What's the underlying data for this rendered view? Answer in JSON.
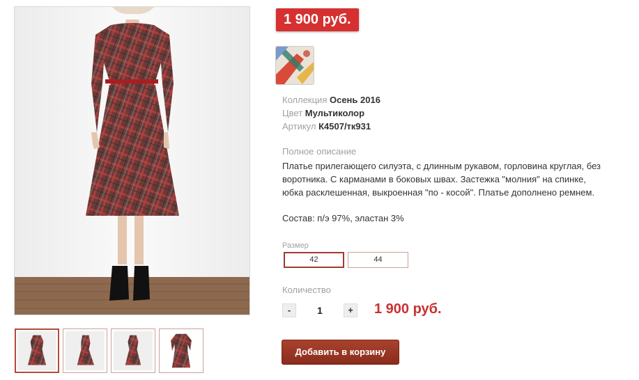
{
  "product": {
    "price_badge": "1 900 руб.",
    "properties": [
      {
        "label": "Коллекция",
        "value": "Осень 2016"
      },
      {
        "label": "Цвет",
        "value": "Мультиколор"
      },
      {
        "label": "Артикул",
        "value": "К4507/тк931"
      }
    ],
    "description_title": "Полное описание",
    "description": "Платье прилегающего силуэта, с длинным рукавом, горловина круглая, без воротника. С карманами в боковых швах. Застежка \"молния\" на спинке, юбка расклешенная, выкроенная \"по - косой\". Платье дополнено ремнем.",
    "composition": "Состав: п/э 97%, эластан 3%"
  },
  "size": {
    "label": "Размер",
    "options": [
      "42",
      "44"
    ],
    "selected": "42"
  },
  "quantity": {
    "label": "Количество",
    "minus": "-",
    "value": "1",
    "plus": "+",
    "total": "1 900 руб."
  },
  "add_to_cart": "Добавить в корзину",
  "gallery": {
    "thumb_count": 4,
    "active_index": 0
  },
  "colors": {
    "price_bg": "#d63030",
    "accent": "#a03a2c",
    "total_price": "#cc3030",
    "dress_base": "#6e3a36",
    "dress_plaid_red": "#b33a3a"
  }
}
